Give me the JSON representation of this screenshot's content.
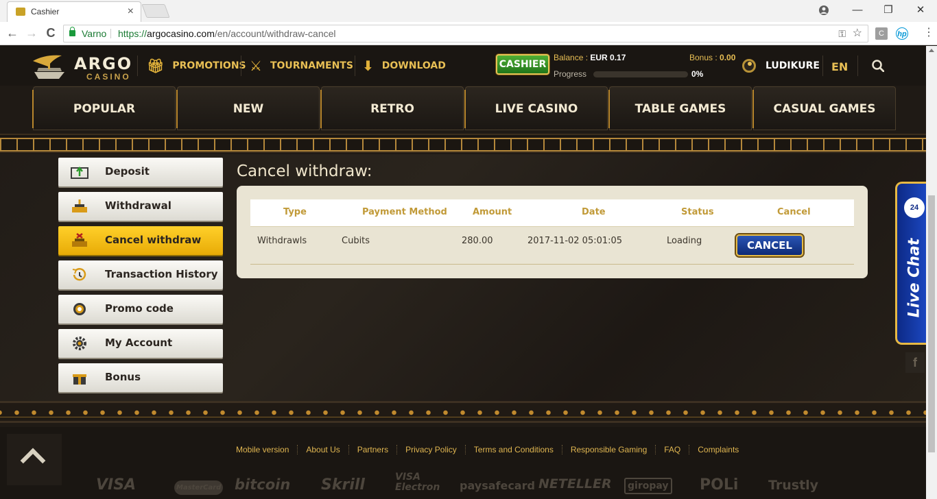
{
  "browser": {
    "tab_title": "Cashier",
    "tab_close": "×",
    "profile_icon": "person-icon",
    "win_minimize": "—",
    "win_restore": "❐",
    "win_close": "✕",
    "back": "←",
    "forward": "→",
    "reload": "C",
    "secure_label": "Varno",
    "url_scheme": "https://",
    "url_host": "argocasino.com",
    "url_path": "/en/account/withdraw-cancel",
    "key_icon": "key-icon",
    "bookmark_icon": "star-icon",
    "ext_1": "C",
    "ext_2": "hp",
    "menu": "⋮"
  },
  "header": {
    "logo_title": "ARGO",
    "logo_sub": "CASINO",
    "nav": [
      {
        "label": "PROMOTIONS",
        "icon": "gift-icon"
      },
      {
        "label": "TOURNAMENTS",
        "icon": "swords-icon"
      },
      {
        "label": "DOWNLOAD",
        "icon": "download-icon"
      }
    ],
    "cashier_label": "CASHIER",
    "balance_label": "Balance : ",
    "balance_value": "EUR 0.17",
    "bonus_label": "Bonus : ",
    "bonus_value": "0.00",
    "progress_label": "Progress",
    "progress_value": "0%",
    "progress_fraction": 0,
    "username": "LUDIKURE",
    "language": "EN"
  },
  "categories": [
    "POPULAR",
    "NEW",
    "RETRO",
    "LIVE CASINO",
    "TABLE GAMES",
    "CASUAL GAMES"
  ],
  "sidebar": {
    "items": [
      {
        "label": "Deposit",
        "icon": "deposit-icon",
        "active": false
      },
      {
        "label": "Withdrawal",
        "icon": "withdrawal-icon",
        "active": false
      },
      {
        "label": "Cancel withdraw",
        "icon": "cancel-withdraw-icon",
        "active": true
      },
      {
        "label": "Transaction History",
        "icon": "history-icon",
        "active": false
      },
      {
        "label": "Promo code",
        "icon": "promo-chip-icon",
        "active": false
      },
      {
        "label": "My Account",
        "icon": "gear-icon",
        "active": false
      },
      {
        "label": "Bonus",
        "icon": "gift-icon",
        "active": false
      }
    ]
  },
  "main": {
    "title": "Cancel withdraw:",
    "columns": [
      "Type",
      "Payment Method",
      "Amount",
      "Date",
      "Status",
      "Cancel"
    ],
    "rows": [
      {
        "type": "Withdrawls",
        "method": "Cubits",
        "amount": "280.00",
        "date": "2017-11-02 05:01:05",
        "status": "Loading",
        "action": "CANCEL"
      }
    ]
  },
  "livechat": {
    "badge": "24",
    "label": "Live Chat"
  },
  "facebook": "f",
  "footer": {
    "links": [
      "Mobile version",
      "About Us",
      "Partners",
      "Privacy Policy",
      "Terms and Conditions",
      "Responsible Gaming",
      "FAQ",
      "Complaints"
    ],
    "payments": [
      "VISA",
      "MasterCard",
      "bitcoin",
      "Skrill",
      "VISA Electron",
      "paysafecard",
      "NETELLER",
      "giropay",
      "POLi",
      "Trustly"
    ]
  }
}
